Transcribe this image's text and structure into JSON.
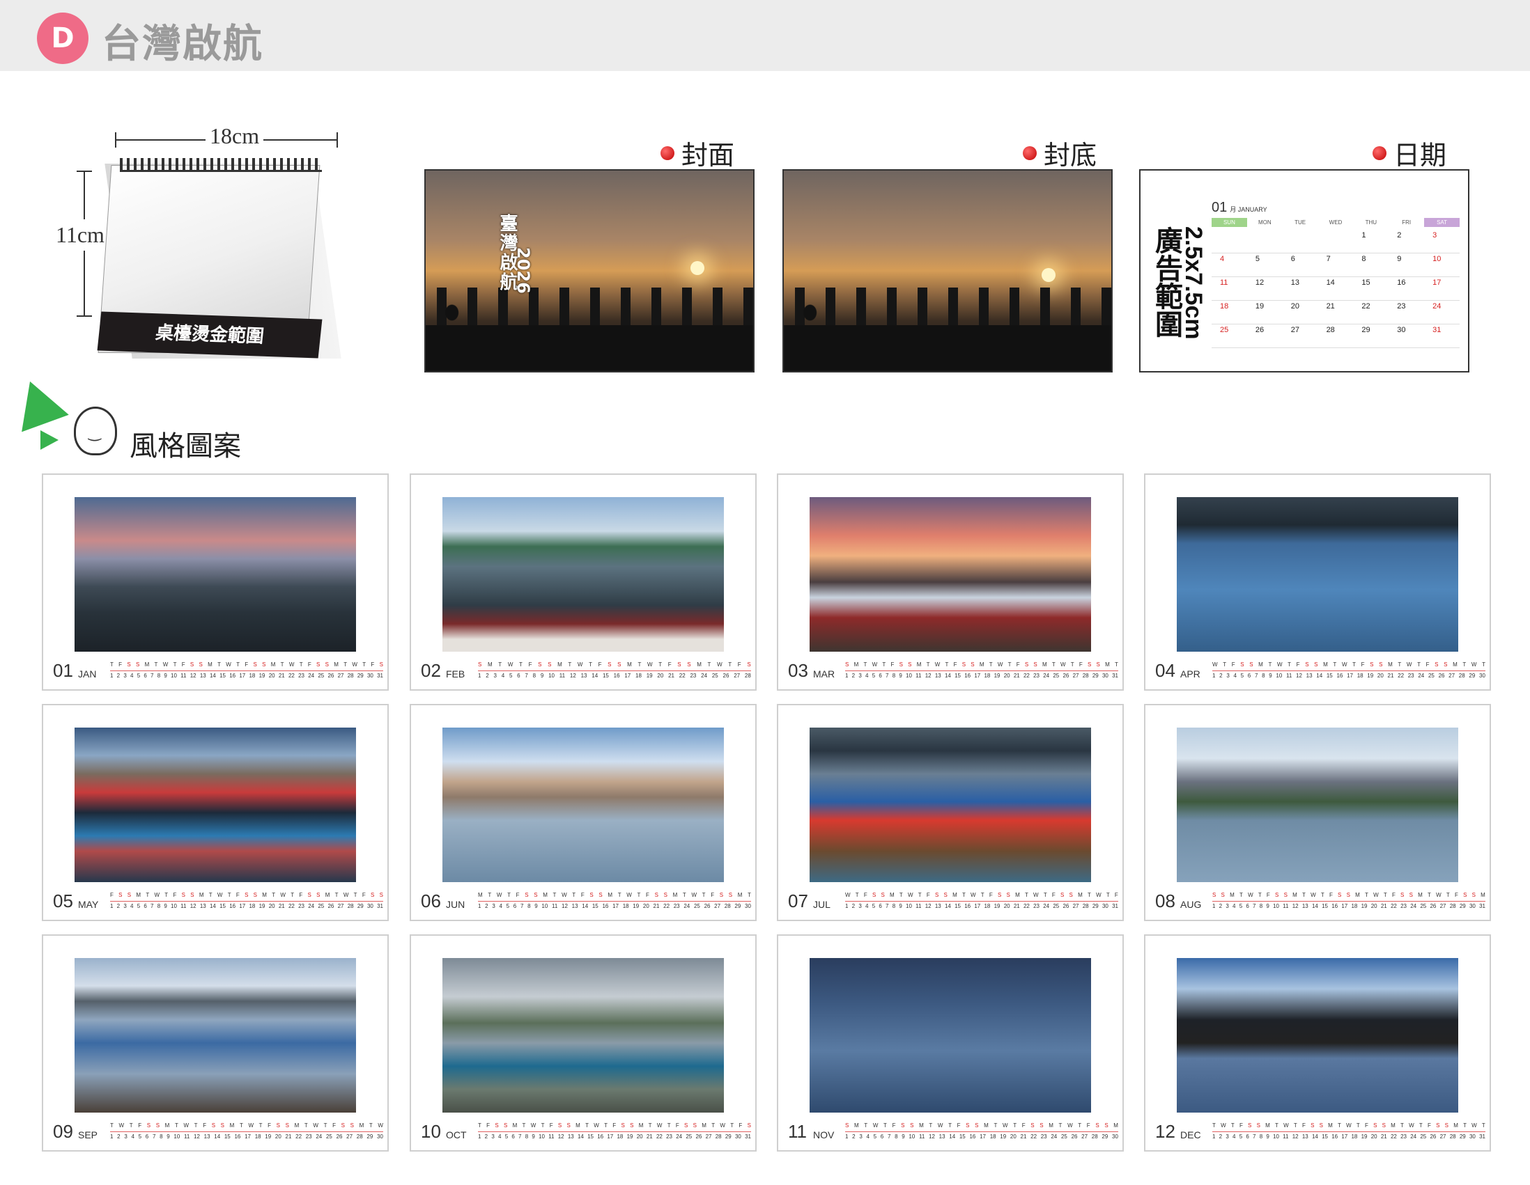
{
  "header": {
    "badge": "D",
    "title": "台灣啟航"
  },
  "sketch": {
    "width_label": "18cm",
    "height_label": "11cm",
    "base_text": "桌檯燙金範圍"
  },
  "sections": {
    "cover": "封面",
    "back": "封底",
    "date": "日期"
  },
  "cover": {
    "title": "臺灣啟航",
    "year": "2026"
  },
  "date_panel": {
    "ad_text": "廣告範圍",
    "ad_size": "2.5x7.5cm",
    "month_num": "01",
    "month_name": "月 JANUARY",
    "dow": [
      "SUN",
      "MON",
      "TUE",
      "WED",
      "THU",
      "FRI",
      "SAT"
    ],
    "days": [
      "",
      "",
      "",
      "",
      "1",
      "2",
      "3",
      "4",
      "5",
      "6",
      "7",
      "8",
      "9",
      "10",
      "11",
      "12",
      "13",
      "14",
      "15",
      "16",
      "17",
      "18",
      "19",
      "20",
      "21",
      "22",
      "23",
      "24",
      "25",
      "26",
      "27",
      "28",
      "29",
      "30",
      "31"
    ]
  },
  "style_heading": "風格圖案",
  "months": [
    {
      "num": "01",
      "abbr": "JAN",
      "dow": "T F S S M T W T F S S M T W T F S S M T W T F S S M T W T F S",
      "days": "1 2 3 4 5 6 7 8 9 10 11 12 13 14 15 16 17 18 19 20 21 22 23 24 25 26 27 28 29 30 31"
    },
    {
      "num": "02",
      "abbr": "FEB",
      "dow": "S M T W T F S S M T W T F S S M T W T F S S M T W T F S",
      "days": "1 2 3 4 5 6 7 8 9 10 11 12 13 14 15 16 17 18 19 20 21 22 23 24 25 26 27 28"
    },
    {
      "num": "03",
      "abbr": "MAR",
      "dow": "S M T W T F S S M T W T F S S M T W T F S S M T W T F S S M T",
      "days": "1 2 3 4 5 6 7 8 9 10 11 12 13 14 15 16 17 18 19 20 21 22 23 24 25 26 27 28 29 30 31"
    },
    {
      "num": "04",
      "abbr": "APR",
      "dow": "W T F S S M T W T F S S M T W T F S S M T W T F S S M T W T",
      "days": "1 2 3 4 5 6 7 8 9 10 11 12 13 14 15 16 17 18 19 20 21 22 23 24 25 26 27 28 29 30"
    },
    {
      "num": "05",
      "abbr": "MAY",
      "dow": "F S S M T W T F S S M T W T F S S M T W T F S S M T W T F S S",
      "days": "1 2 3 4 5 6 7 8 9 10 11 12 13 14 15 16 17 18 19 20 21 22 23 24 25 26 27 28 29 30 31"
    },
    {
      "num": "06",
      "abbr": "JUN",
      "dow": "M T W T F S S M T W T F S S M T W T F S S M T W T F S S M T",
      "days": "1 2 3 4 5 6 7 8 9 10 11 12 13 14 15 16 17 18 19 20 21 22 23 24 25 26 27 28 29 30"
    },
    {
      "num": "07",
      "abbr": "JUL",
      "dow": "W T F S S M T W T F S S M T W T F S S M T W T F S S M T W T F",
      "days": "1 2 3 4 5 6 7 8 9 10 11 12 13 14 15 16 17 18 19 20 21 22 23 24 25 26 27 28 29 30 31"
    },
    {
      "num": "08",
      "abbr": "AUG",
      "dow": "S S M T W T F S S M T W T F S S M T W T F S S M T W T F S S M",
      "days": "1 2 3 4 5 6 7 8 9 10 11 12 13 14 15 16 17 18 19 20 21 22 23 24 25 26 27 28 29 30 31"
    },
    {
      "num": "09",
      "abbr": "SEP",
      "dow": "T W T F S S M T W T F S S M T W T F S S M T W T F S S M T W",
      "days": "1 2 3 4 5 6 7 8 9 10 11 12 13 14 15 16 17 18 19 20 21 22 23 24 25 26 27 28 29 30"
    },
    {
      "num": "10",
      "abbr": "OCT",
      "dow": "T F S S M T W T F S S M T W T F S S M T W T F S S M T W T F S",
      "days": "1 2 3 4 5 6 7 8 9 10 11 12 13 14 15 16 17 18 19 20 21 22 23 24 25 26 27 28 29 30 31"
    },
    {
      "num": "11",
      "abbr": "NOV",
      "dow": "S M T W T F S S M T W T F S S M T W T F S S M T W T F S S M",
      "days": "1 2 3 4 5 6 7 8 9 10 11 12 13 14 15 16 17 18 19 20 21 22 23 24 25 26 27 28 29 30"
    },
    {
      "num": "12",
      "abbr": "DEC",
      "dow": "T W T F S S M T W T F S S M T W T F S S M T W T F S S M T W T",
      "days": "1 2 3 4 5 6 7 8 9 10 11 12 13 14 15 16 17 18 19 20 21 22 23 24 25 26 27 28 29 30 31"
    }
  ]
}
